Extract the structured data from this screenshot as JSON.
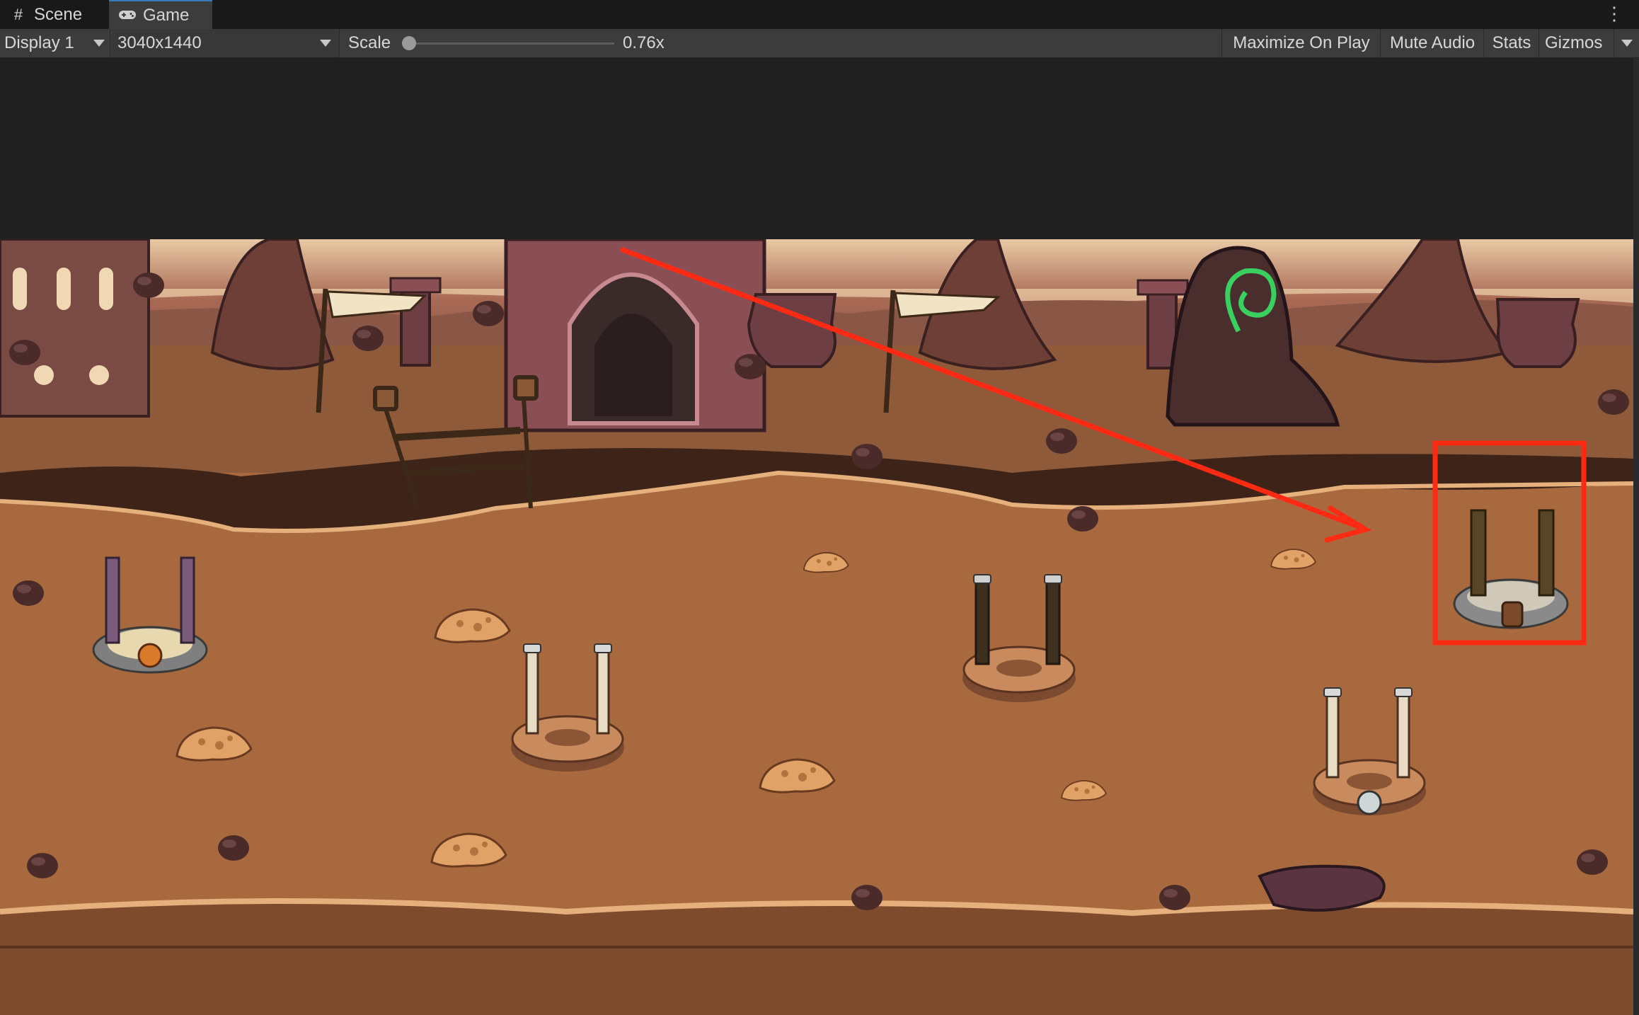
{
  "tabs": {
    "scene": {
      "icon": "grid-icon",
      "label": "Scene"
    },
    "game": {
      "icon": "gamepad-icon",
      "label": "Game"
    }
  },
  "toolbar": {
    "display": "Display 1",
    "resolution": "3040x1440",
    "scale_label": "Scale",
    "scale_value": "0.76x",
    "scale_fraction": 0.0,
    "maximize_on_play": "Maximize On Play",
    "mute_audio": "Mute Audio",
    "stats": "Stats",
    "gizmos": "Gizmos"
  },
  "annotation": {
    "color": "#ff2a14",
    "type": "arrow-to-highlighted-tower-slot"
  },
  "colors": {
    "ground": "#a8693f",
    "path": "#7a4a2c",
    "sky": "#7b4c3c",
    "accent": "#3a79bb"
  }
}
